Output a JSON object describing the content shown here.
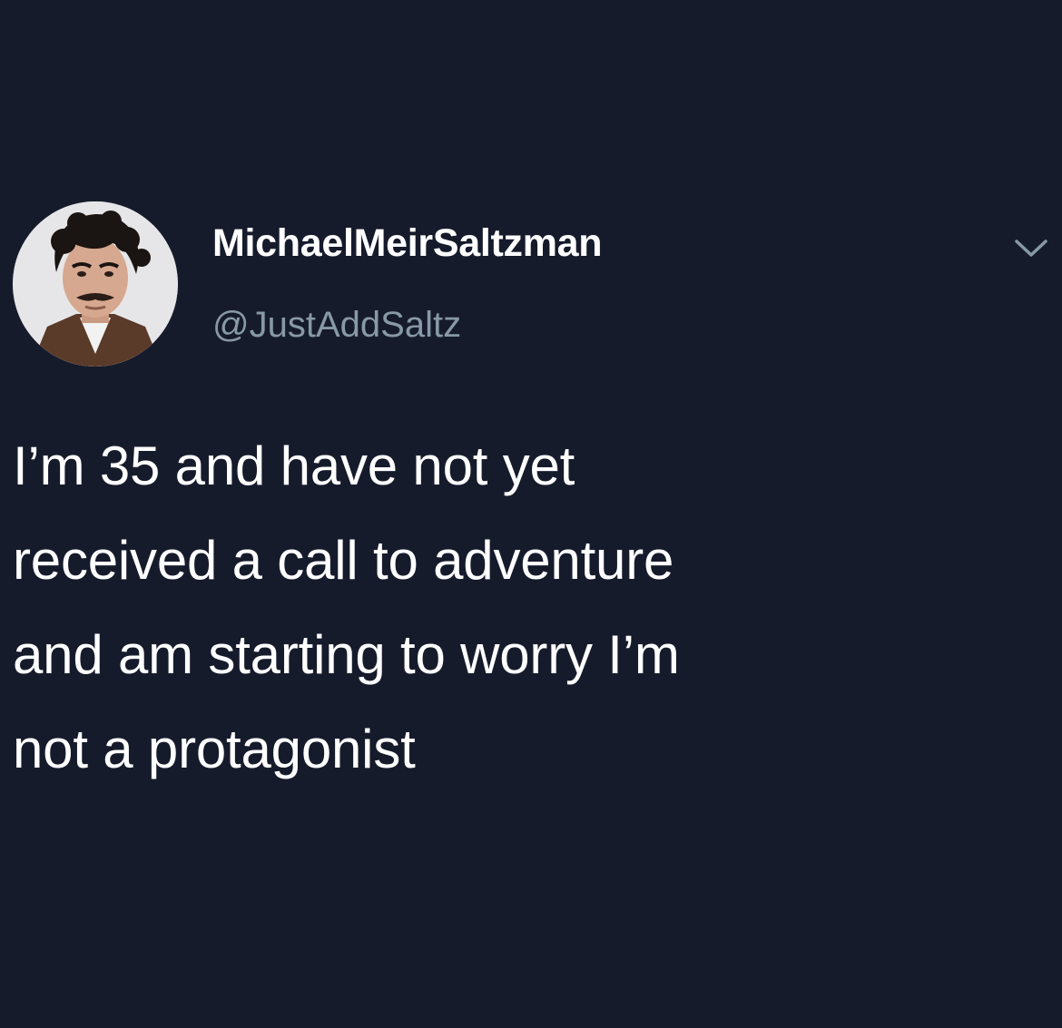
{
  "tweet": {
    "display_name": "MichaelMeirSaltzman",
    "handle": "@JustAddSaltz",
    "text": "I’m 35 and have not yet\nreceived a call to adventure\nand am starting to worry I’m\nnot a protagonist",
    "avatar_icon": "profile-photo",
    "menu_icon": "chevron-down-icon"
  },
  "colors": {
    "background": "#161b2c",
    "text": "#ffffff",
    "handle": "#8899a6",
    "chevron": "#8899a6"
  }
}
